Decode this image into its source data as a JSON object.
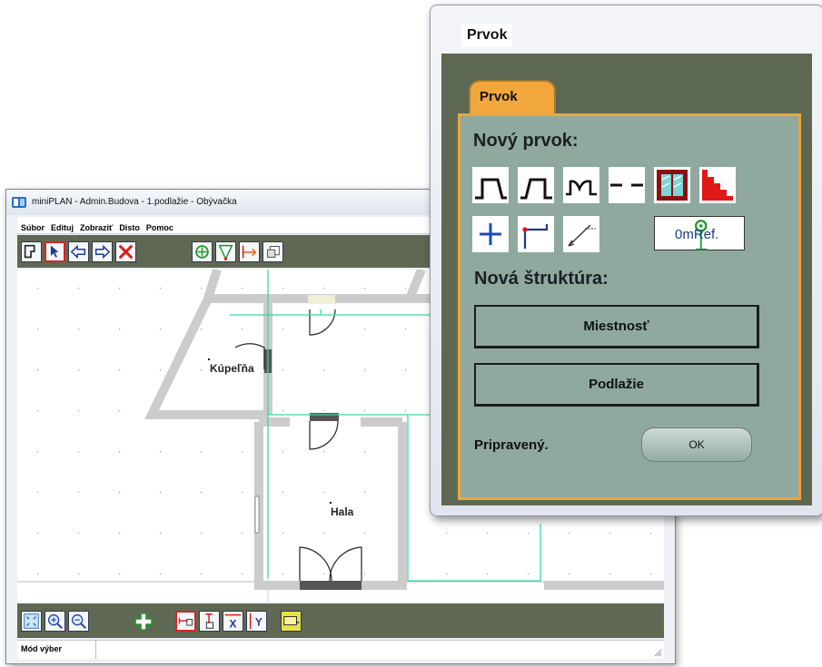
{
  "main_window": {
    "title": "miniPLAN - Admin.Budova - 1.podlažie - Obývačka",
    "menu": [
      "Súbor",
      "Edituj",
      "Zobraziť",
      "Disto",
      "Pomoc"
    ],
    "top_toolbar_icons": [
      "new-object-icon",
      "select-arrow-icon",
      "arrow-left-icon",
      "arrow-right-icon",
      "delete-x-icon",
      "target-icon",
      "triangle-icon",
      "measure-icon",
      "properties-icon"
    ],
    "rooms": [
      "Kúpeľňa",
      "Hala"
    ],
    "bottom_toolbar_icons": [
      "zoom-fit-icon",
      "zoom-in-icon",
      "zoom-out-icon",
      "add-icon",
      "dimension-h-icon",
      "dimension-v-icon",
      "axis-x-icon",
      "axis-y-icon",
      "tape-measure-icon"
    ],
    "axis_x_label": "X",
    "axis_y_label": "Y",
    "status": "Mód výber"
  },
  "dialog": {
    "title": "Prvok",
    "tab_label": "Prvok",
    "new_element_heading": "Nový prvok:",
    "new_element_icons": [
      "door-icon",
      "door-alt-icon",
      "double-door-icon",
      "opening-icon",
      "window-icon",
      "stairs-icon",
      "point-icon",
      "wall-corner-icon",
      "dimension-line-icon",
      "reference-icon"
    ],
    "ref_label": "0mRef.",
    "new_structure_heading": "Nová štruktúra:",
    "room_button": "Miestnosť",
    "floor_button": "Podlažie",
    "status": "Pripravený.",
    "ok_button": "OK"
  },
  "colors": {
    "toolbar_bg": "#5f6853",
    "panel_bg": "#8fa99f",
    "tab_orange": "#f2a73c",
    "wall_grey": "#cccccc",
    "plan_cyan": "#3cd6a8"
  }
}
